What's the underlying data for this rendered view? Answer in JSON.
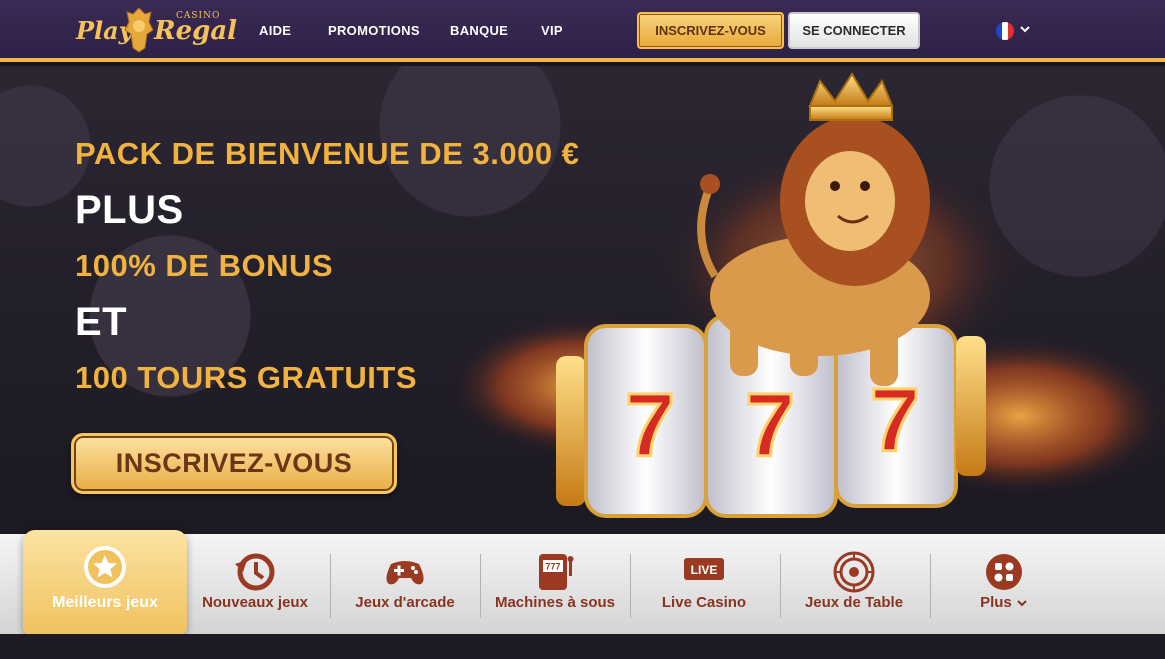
{
  "header": {
    "logo": {
      "play": "Play",
      "regal": "Regal",
      "casino": "CASINO"
    },
    "nav": [
      "AIDE",
      "PROMOTIONS",
      "BANQUE",
      "VIP"
    ],
    "signup_label": "INSCRIVEZ-VOUS",
    "login_label": "SE CONNECTER",
    "language_icon": "france-flag-icon"
  },
  "hero": {
    "line1": "PACK DE BIENVENUE DE 3.000 €",
    "line2": "PLUS",
    "line3": "100% DE BONUS",
    "line4": "ET",
    "line5": "100 TOURS GRATUITS",
    "cta_label": "INSCRIVEZ-VOUS",
    "reels": [
      "7",
      "7",
      "7"
    ]
  },
  "categories": [
    {
      "label": "Meilleurs jeux",
      "icon": "star-icon",
      "active": true
    },
    {
      "label": "Nouveaux jeux",
      "icon": "history-icon"
    },
    {
      "label": "Jeux d'arcade",
      "icon": "gamepad-icon"
    },
    {
      "label": "Machines à sous",
      "icon": "slot-machine-icon",
      "icon_text": "777"
    },
    {
      "label": "Live Casino",
      "icon": "live-icon",
      "icon_text": "LIVE"
    },
    {
      "label": "Jeux de Table",
      "icon": "roulette-icon"
    },
    {
      "label": "Plus",
      "icon": "grid-icon"
    }
  ],
  "colors": {
    "accent": "#f2b240",
    "header_bg": "#3a2a55",
    "category_text": "#8a3320"
  }
}
